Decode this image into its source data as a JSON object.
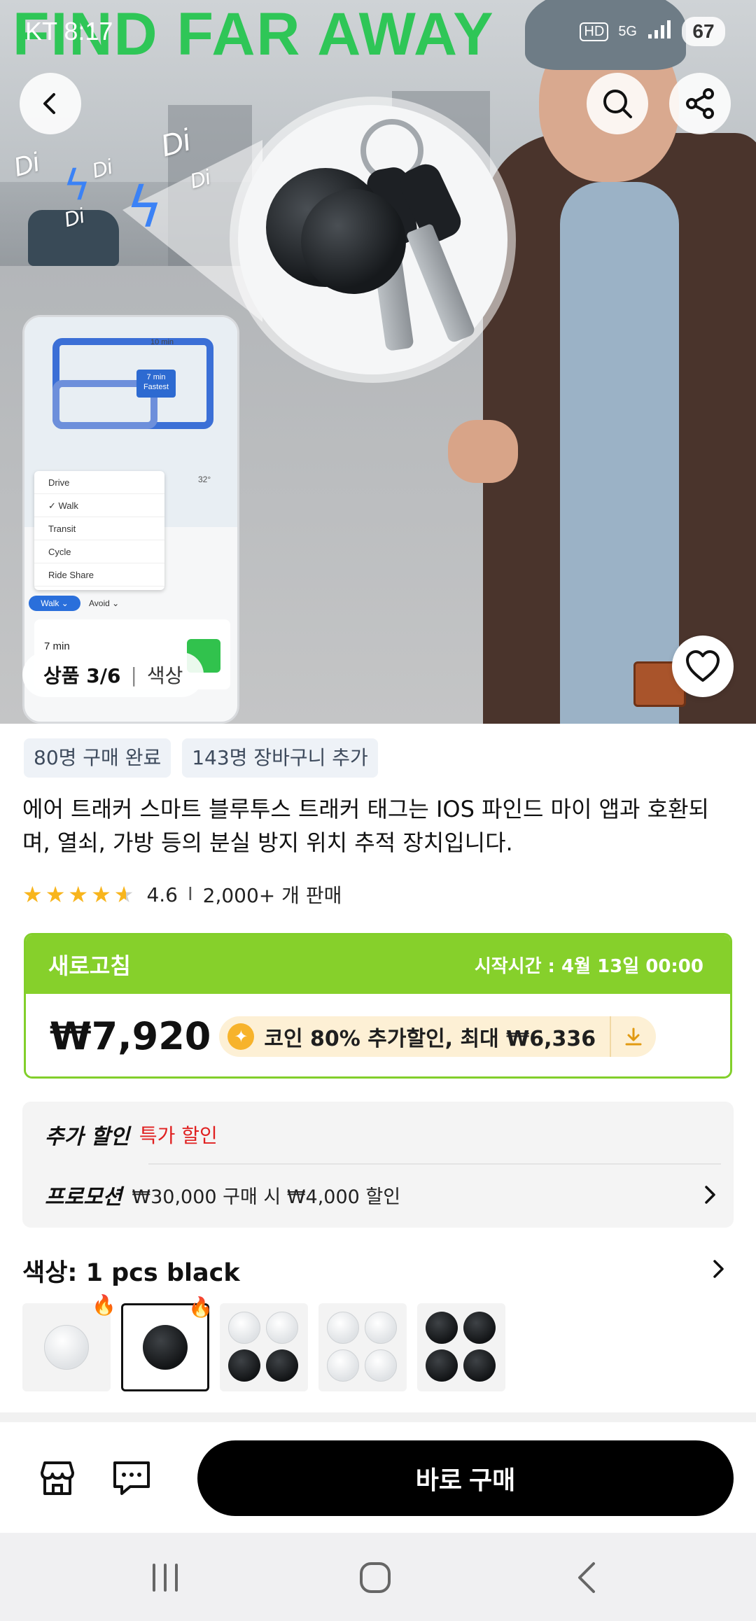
{
  "status_bar": {
    "time": "KT 8:17",
    "network": "5G",
    "battery": "67"
  },
  "hero": {
    "banner": "FIND FAR AWAY",
    "di_labels": [
      "Di",
      "Di",
      "Di",
      "Di",
      "Di"
    ],
    "phone_mock": {
      "chip": "7 min Fastest",
      "time_chip": "10 min",
      "menu": [
        "Drive",
        "✓ Walk",
        "Transit",
        "Cycle",
        "Ride Share"
      ],
      "walk_pill": "Walk ⌄",
      "avoid": "Avoid ⌄",
      "eta": "7 min",
      "temp": "32°"
    },
    "pager": {
      "count": "상품 3/6",
      "label": "색상"
    }
  },
  "badges": [
    "80명 구매 완료",
    "143명 장바구니 추가"
  ],
  "product_title": "에어 트래커 스마트 블루투스 트래커 태그는 IOS 파인드 마이 앱과 호환되며, 열쇠, 가방 등의 분실 방지 위치 추적 장치입니다.",
  "rating": {
    "score": "4.6",
    "stars": 4.6,
    "sold": "2,000+ 개 판매"
  },
  "deal": {
    "label": "새로고침",
    "start": "시작시간 :  4월 13일 00:00",
    "price": "₩7,920",
    "coin_text": "코인 80% 추가할인, 최대 ₩6,336",
    "accent": "#86d02b"
  },
  "promo": {
    "extra_label": "추가 할인",
    "extra_value": "특가 할인",
    "promo_label": "프로모션",
    "promo_value": "₩30,000 구매 시 ₩4,000 할인"
  },
  "color": {
    "title": "색상: 1 pcs black",
    "options": [
      "1 pcs white",
      "1 pcs black",
      "2 white 2 black",
      "4 pcs white",
      "4 pcs black"
    ],
    "selected": 1
  },
  "bottom": {
    "buy_label": "바로 구매"
  }
}
